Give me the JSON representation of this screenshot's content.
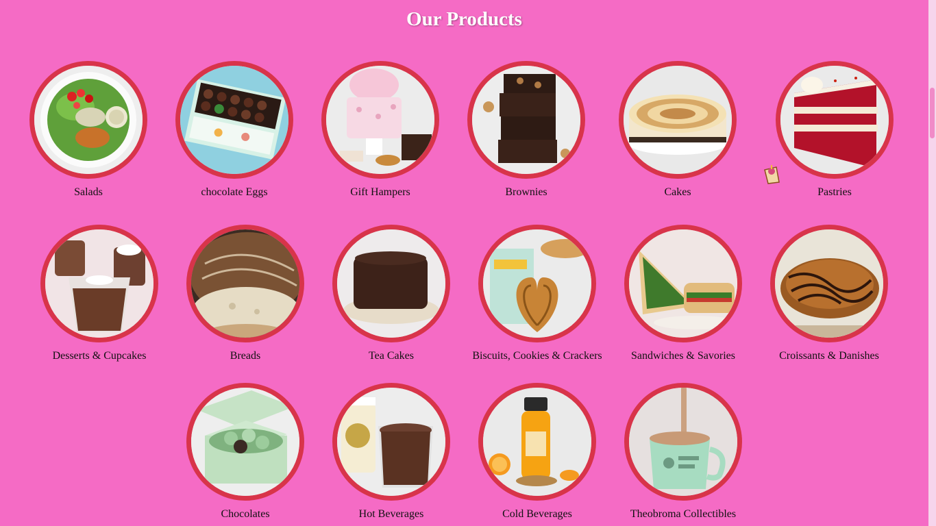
{
  "page": {
    "title": "Our Products"
  },
  "products": [
    {
      "label": "Salads",
      "icon": "salad-bowl"
    },
    {
      "label": "chocolate Eggs",
      "icon": "chocolate-eggs-box"
    },
    {
      "label": "Gift Hampers",
      "icon": "gift-hamper"
    },
    {
      "label": "Brownies",
      "icon": "brownie-stack"
    },
    {
      "label": "Cakes",
      "icon": "meringue-cake"
    },
    {
      "label": "Pastries",
      "icon": "red-velvet-pastry"
    },
    {
      "label": "Desserts & Cupcakes",
      "icon": "dessert-cups"
    },
    {
      "label": "Breads",
      "icon": "sourdough-bread"
    },
    {
      "label": "Tea Cakes",
      "icon": "chocolate-tea-cake"
    },
    {
      "label": "Biscuits, Cookies & Crackers",
      "icon": "palmier-cookie"
    },
    {
      "label": "Sandwiches & Savories",
      "icon": "sandwich"
    },
    {
      "label": "Croissants & Danishes",
      "icon": "chocolate-croissant"
    },
    {
      "label": "Chocolates",
      "icon": "chocolate-box"
    },
    {
      "label": "Hot Beverages",
      "icon": "hot-chocolate-cup"
    },
    {
      "label": "Cold Beverages",
      "icon": "orange-juice-bottle"
    },
    {
      "label": "Theobroma Collectibles",
      "icon": "mint-mug"
    }
  ],
  "colors": {
    "background": "#f56bc5",
    "ring": "#d8344a",
    "title": "#ffffff"
  }
}
